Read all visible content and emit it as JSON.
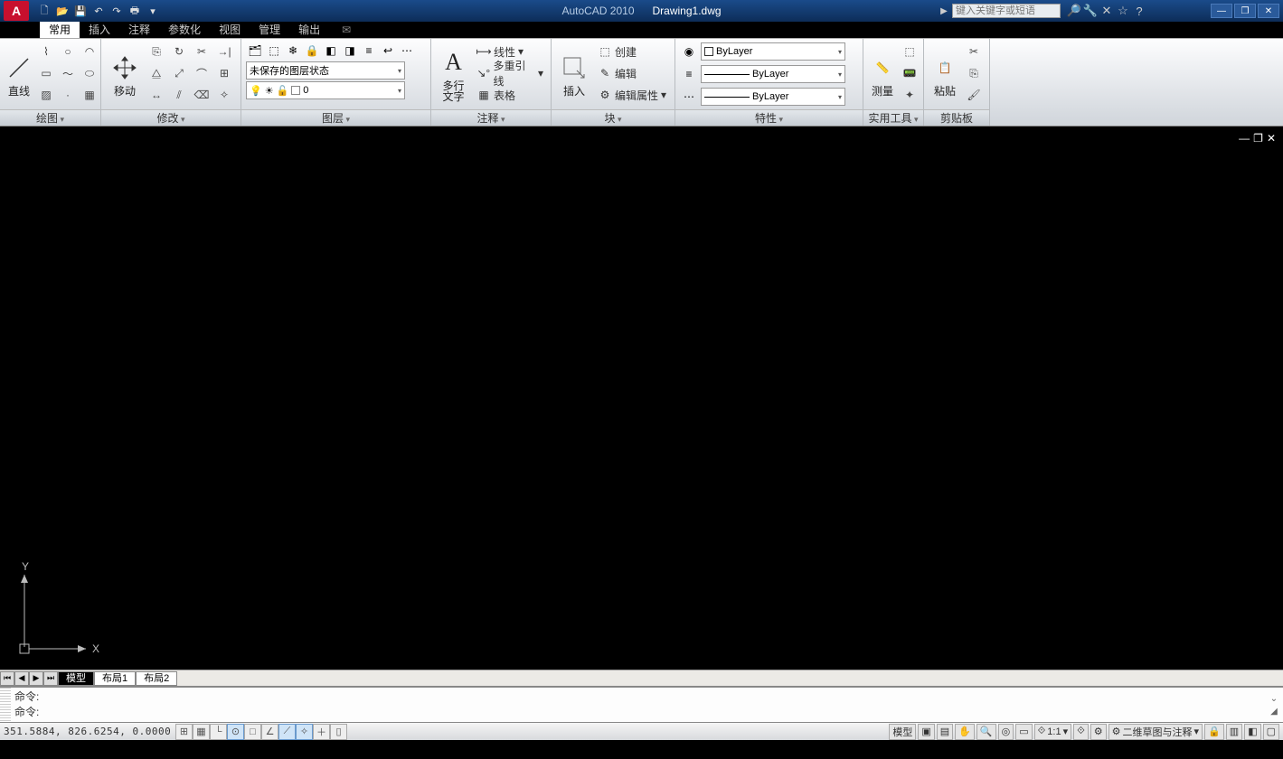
{
  "title": {
    "app": "AutoCAD 2010",
    "doc": "Drawing1.dwg"
  },
  "search": {
    "placeholder": "键入关键字或短语"
  },
  "tabs": [
    "常用",
    "插入",
    "注释",
    "参数化",
    "视图",
    "管理",
    "输出"
  ],
  "activeTab": "常用",
  "panels": {
    "draw": {
      "label": "绘图",
      "line": "直线"
    },
    "modify": {
      "label": "修改",
      "move": "移动"
    },
    "layers": {
      "label": "图层",
      "state": "未保存的图层状态",
      "current": "0"
    },
    "annot": {
      "label": "注释",
      "mtext": "多行\n文字",
      "linear": "线性",
      "mleader": "多重引线",
      "table": "表格"
    },
    "block": {
      "label": "块",
      "insert": "插入",
      "create": "创建",
      "edit": "编辑",
      "editattr": "编辑属性"
    },
    "prop": {
      "label": "特性",
      "color": "ByLayer",
      "lw": "ByLayer",
      "lt": "ByLayer"
    },
    "util": {
      "label": "实用工具",
      "measure": "测量"
    },
    "clip": {
      "label": "剪贴板",
      "paste": "粘贴"
    }
  },
  "layouts": {
    "model": "模型",
    "l1": "布局1",
    "l2": "布局2"
  },
  "cmd": {
    "l1": "命令:",
    "l2": "命令:"
  },
  "status": {
    "coords": "351.5884, 826.6254, 0.0000",
    "model": "模型",
    "scale": "1:1",
    "ws": "二维草图与注释"
  },
  "ucs": {
    "x": "X",
    "y": "Y"
  }
}
